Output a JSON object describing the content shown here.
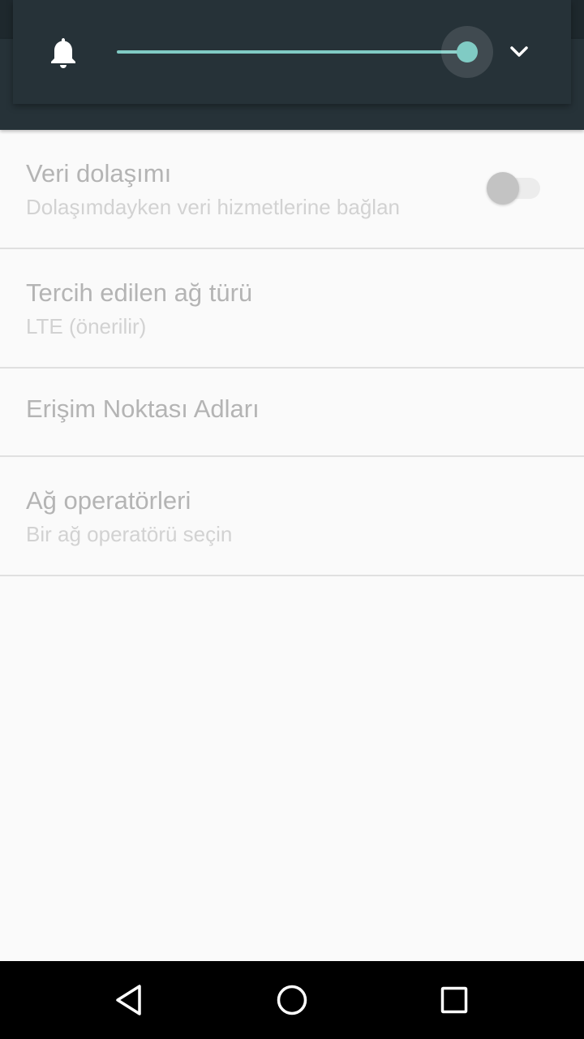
{
  "volume_panel": {
    "level": 1.0,
    "icons": {
      "ringer": "bell-icon",
      "expand": "chevron-down-icon"
    },
    "colors": {
      "panel": "#263238",
      "accent": "#80cbc4"
    }
  },
  "settings": {
    "items": [
      {
        "title": "Veri dolaşımı",
        "summary": "Dolaşımdayken veri hizmetlerine bağlan",
        "toggle_on": false
      },
      {
        "title": "Tercih edilen ağ türü",
        "summary": "LTE (önerilir)"
      },
      {
        "title": "Erişim Noktası Adları"
      },
      {
        "title": "Ağ operatörleri",
        "summary": "Bir ağ operatörü seçin"
      }
    ]
  },
  "nav_bar": {
    "icons": [
      "back-icon",
      "home-icon",
      "recents-icon"
    ]
  }
}
